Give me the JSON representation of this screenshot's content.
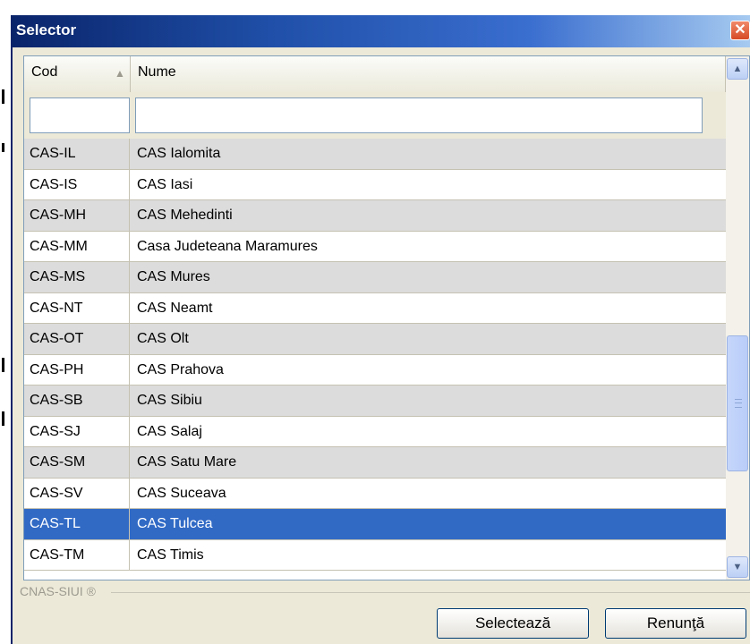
{
  "window": {
    "title": "Selector",
    "close_glyph": "✕"
  },
  "grid": {
    "columns": [
      "Cod",
      "Nume"
    ],
    "sort_indicator": "▲",
    "filters": {
      "cod_value": "",
      "nume_value": ""
    },
    "rows": [
      [
        "CAS-IL",
        "CAS Ialomita"
      ],
      [
        "CAS-IS",
        "CAS  Iasi"
      ],
      [
        "CAS-MH",
        "CAS  Mehedinti"
      ],
      [
        "CAS-MM",
        "Casa Judeteana Maramures"
      ],
      [
        "CAS-MS",
        "CAS  Mures"
      ],
      [
        "CAS-NT",
        "CAS Neamt"
      ],
      [
        "CAS-OT",
        "CAS Olt"
      ],
      [
        "CAS-PH",
        "CAS  Prahova"
      ],
      [
        "CAS-SB",
        "CAS Sibiu"
      ],
      [
        "CAS-SJ",
        "CAS  Salaj"
      ],
      [
        "CAS-SM",
        "CAS  Satu Mare"
      ],
      [
        "CAS-SV",
        "CAS  Suceava"
      ],
      [
        "CAS-TL",
        "CAS Tulcea"
      ],
      [
        "CAS-TM",
        "CAS  Timis"
      ]
    ],
    "selected_code": "CAS-TL"
  },
  "footer": {
    "brand_label": "CNAS-SIUI ®"
  },
  "buttons": {
    "select_label": "Selectează",
    "cancel_label": "Renunţă"
  },
  "colors": {
    "title_bar": "#0a246a",
    "selected_row": "#316ac5",
    "alt_row": "#dcdcdc"
  },
  "icons": {
    "scroll_up": "chevron-up-icon",
    "scroll_down": "chevron-down-icon",
    "close": "close-icon",
    "sort": "sort-ascending-icon"
  }
}
